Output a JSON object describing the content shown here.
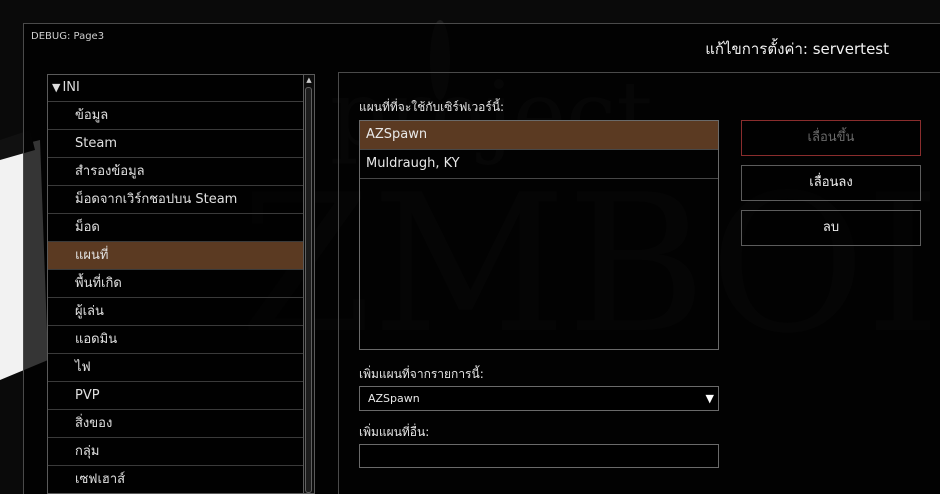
{
  "debug_label": "DEBUG: Page3",
  "page_title": "แก้ไขการตั้งค่า: servertest",
  "sidebar": {
    "group_label": "INI",
    "items": [
      {
        "label": "ข้อมูล"
      },
      {
        "label": "Steam"
      },
      {
        "label": "สำรองข้อมูล"
      },
      {
        "label": "ม็อดจากเวิร์กชอปบน Steam"
      },
      {
        "label": "ม็อด"
      },
      {
        "label": "แผนที่"
      },
      {
        "label": "พื้นที่เกิด"
      },
      {
        "label": "ผู้เล่น"
      },
      {
        "label": "แอดมิน"
      },
      {
        "label": "ไฟ"
      },
      {
        "label": "PVP"
      },
      {
        "label": "สิ่งของ"
      },
      {
        "label": "กลุ่ม"
      },
      {
        "label": "เซฟเฮาส์"
      }
    ],
    "selected_index": 5
  },
  "maps_section": {
    "label": "แผนที่ที่จะใช้กับเซิร์ฟเวอร์นี้:",
    "maps": [
      "AZSpawn",
      "Muldraugh, KY"
    ],
    "selected_index": 0
  },
  "buttons": {
    "move_up": "เลื่อนขึ้น",
    "move_down": "เลื่อนลง",
    "delete": "ลบ"
  },
  "add_from_list": {
    "label": "เพิ่มแผนที่จากรายการนี้:",
    "selected_value": "AZSpawn"
  },
  "add_other": {
    "label": "เพิ่มแผนที่อื่น:",
    "value": ""
  },
  "colors": {
    "selection": "#5b3a22",
    "disabled_border": "#8a2d2d"
  }
}
